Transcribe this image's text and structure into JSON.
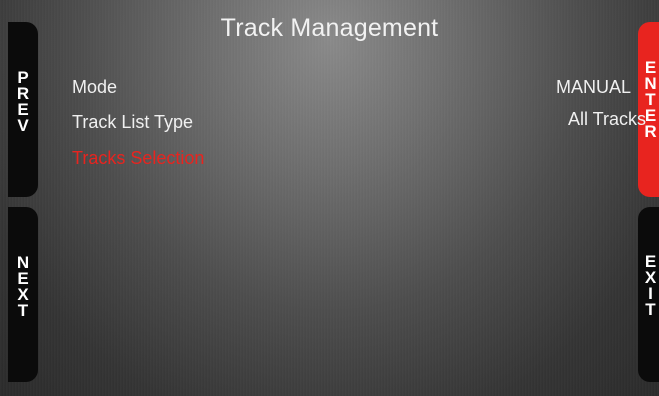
{
  "title": "Track Management",
  "buttons": {
    "prev": [
      "P",
      "R",
      "E",
      "V"
    ],
    "next": [
      "N",
      "E",
      "X",
      "T"
    ],
    "enter": [
      "E",
      "N",
      "T",
      "E",
      "R"
    ],
    "exit": [
      "E",
      "X",
      "I",
      "T"
    ]
  },
  "menu": [
    {
      "label": "Mode",
      "value": "MANUAL",
      "selected": false
    },
    {
      "label": "Track List Type",
      "value": "All Tracks",
      "selected": false
    },
    {
      "label": "Tracks Selection",
      "value": "",
      "selected": true
    }
  ],
  "colors": {
    "accent": "#e8241f",
    "text": "#f0f0f0",
    "button_dark": "#0b0b0b"
  }
}
